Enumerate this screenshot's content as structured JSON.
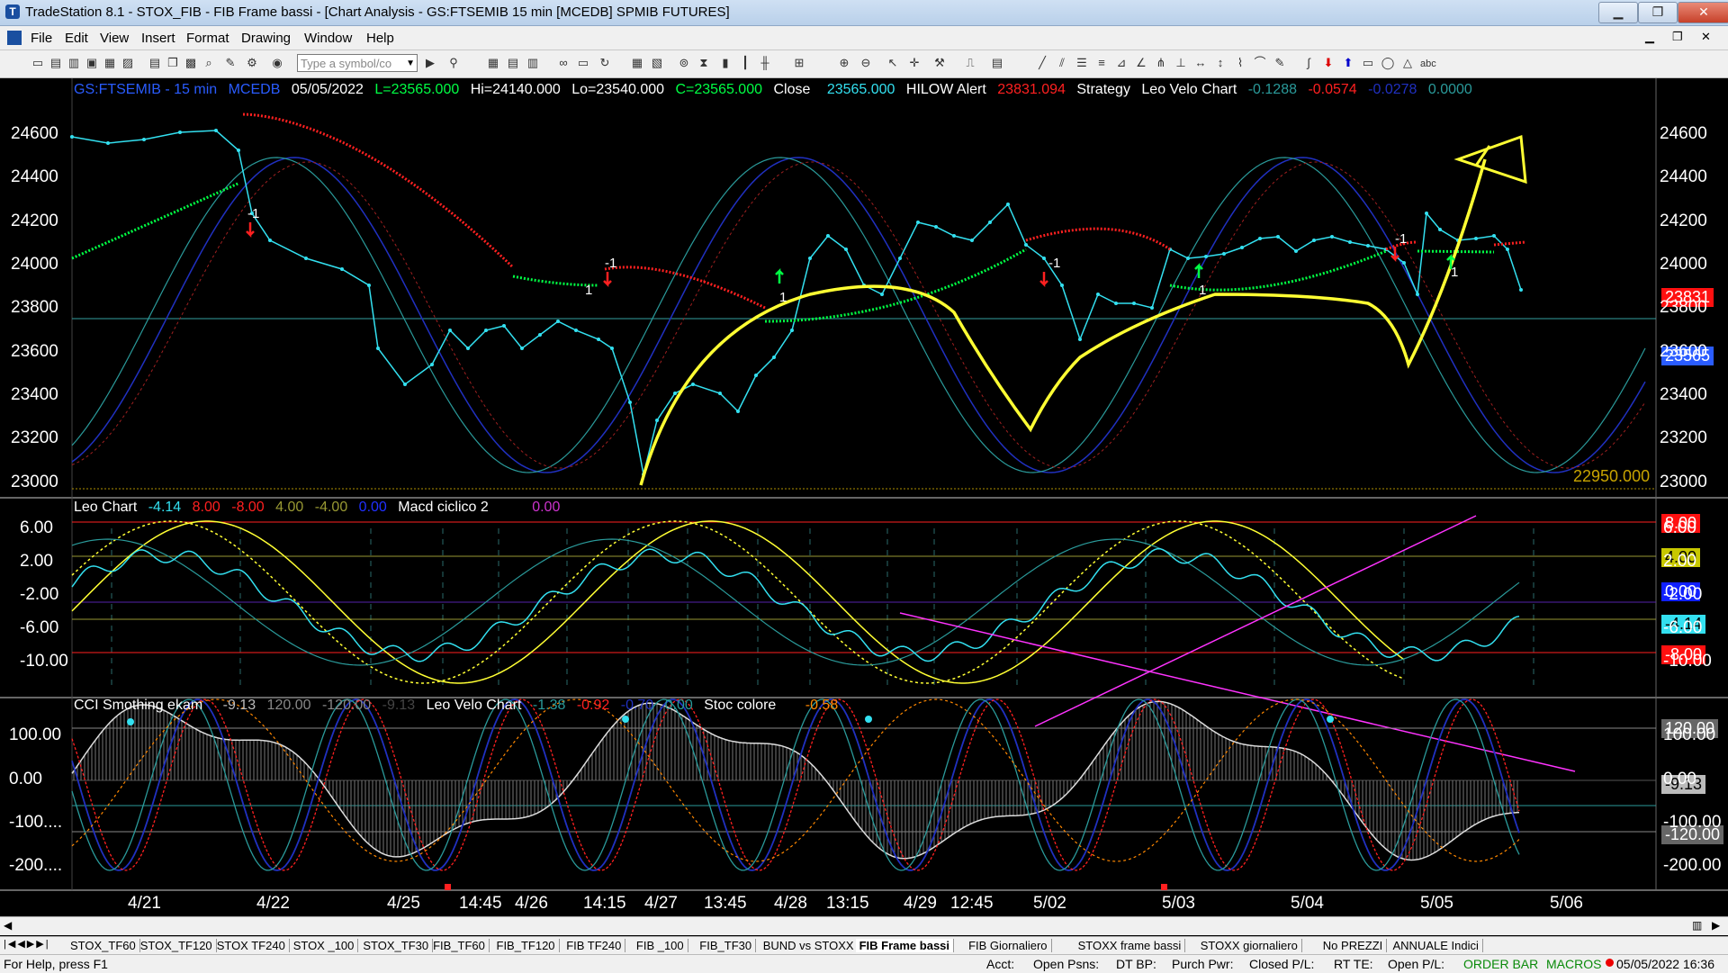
{
  "window": {
    "title": "TradeStation 8.1 - STOX_FIB - FIB Frame bassi - [Chart Analysis - GS:FTSEMIB  15 min  [MCEDB] SPMIB FUTURES]",
    "minimize": "▁",
    "maximize": "❐",
    "close": "✕"
  },
  "menu": [
    "File",
    "Edit",
    "View",
    "Insert",
    "Format",
    "Drawing",
    "Window",
    "Help"
  ],
  "toolbar": {
    "symbol_placeholder": "Type a symbol/co"
  },
  "price_header": {
    "symbol": "GS:FTSEMIB - 15 min",
    "feed": "MCEDB",
    "date": "05/05/2022",
    "last": "L=23565.000",
    "hi": "Hi=24140.000",
    "lo": "Lo=23540.000",
    "close_value": "C=23565.000",
    "close_label": "Close",
    "close_num": "23565.000",
    "hilow": "HILOW Alert",
    "hilow_val": "23831.094",
    "strategy": "Strategy",
    "leovelo": "Leo Velo Chart",
    "lv1": "-0.1288",
    "lv2": "-0.0574",
    "lv3": "-0.0278",
    "lv4": "0.0000"
  },
  "leo_header": {
    "title": "Leo Chart",
    "v1": "-4.14",
    "v2": "8.00",
    "v3": "-8.00",
    "v4": "4.00",
    "v5": "-4.00",
    "v6": "0.00",
    "macd": "Macd ciclico 2",
    "macd_val": "0.00"
  },
  "cci_header": {
    "title": "CCI Smothing ekam",
    "v1": "-9.13",
    "v2": "120.00",
    "v3": "-120.00",
    "v4": "-9.13",
    "leovelo": "Leo Velo Chart",
    "lv1": "-1.38",
    "lv2": "-0.92",
    "lv3": "-0.70",
    "lv4": "0.00",
    "stoc": "Stoc colore",
    "stoc_val": "-0.58"
  },
  "price_axis": [
    "24600",
    "24400",
    "24200",
    "24000",
    "23800",
    "23600",
    "23400",
    "23200",
    "23000"
  ],
  "leo_axis": [
    "6.00",
    "2.00",
    "-2.00",
    "-6.00",
    "-10.00"
  ],
  "cci_axis": [
    "100.00",
    "0.00",
    "-100....",
    "-200...."
  ],
  "right_price_axis": [
    "24600",
    "24400",
    "24200",
    "24000",
    "23800",
    "23600",
    "23400",
    "23200",
    "23000"
  ],
  "right_leo_axis": [
    "6.00",
    "2.00",
    "-2.00",
    "-6.00",
    "-10.00"
  ],
  "right_cci_axis": [
    "100.00",
    "0.00",
    "-100.00",
    "-200.00"
  ],
  "price_badges": {
    "hilow": "23831",
    "last": "23565",
    "level": "22950.000"
  },
  "leo_badges": {
    "b1": "8.00",
    "b2": "4.00",
    "b3": "0.00",
    "b4": "-4.14",
    "b5": "-8.00"
  },
  "cci_badges": {
    "b1": "120.00",
    "b2": "-9.13",
    "b3": "-120.00"
  },
  "time_axis": [
    "4/21",
    "4/22",
    "4/25",
    "14:45",
    "4/26",
    "14:15",
    "4/27",
    "13:45",
    "4/28",
    "13:15",
    "4/29",
    "12:45",
    "5/02",
    "5/03",
    "5/04",
    "5/05",
    "5/06"
  ],
  "markers": {
    "minus1": "-1",
    "plus1": "1"
  },
  "tabs": [
    "STOX_TF60",
    "STOX_TF120",
    "STOX TF240",
    "STOX _100",
    "STOX_TF30",
    "FIB_TF60",
    "FIB_TF120",
    "FIB TF240",
    "FIB _100",
    "FIB_TF30",
    "BUND vs STOXX",
    "FIB Frame bassi",
    "FIB Giornaliero",
    "STOXX frame bassi",
    "STOXX giornaliero",
    "No PREZZI",
    "ANNUALE Indici"
  ],
  "status": {
    "help": "For Help, press F1",
    "acct": "Acct:",
    "open_psns": "Open Psns:",
    "dtbp": "DT BP:",
    "purch": "Purch Pwr:",
    "closed": "Closed P/L:",
    "rtte": "RT TE:",
    "openpl": "Open P/L:",
    "orderbar": "ORDER BAR",
    "macros": "MACROS",
    "datetime": "05/05/2022 16:36"
  },
  "colors": {
    "cyan": "#33e0f0",
    "green": "#00ff44",
    "red": "#ff2020",
    "yellow": "#ffff33",
    "magenta": "#ff33ff",
    "navy": "#2030c0",
    "teal": "#2a9a9a"
  }
}
